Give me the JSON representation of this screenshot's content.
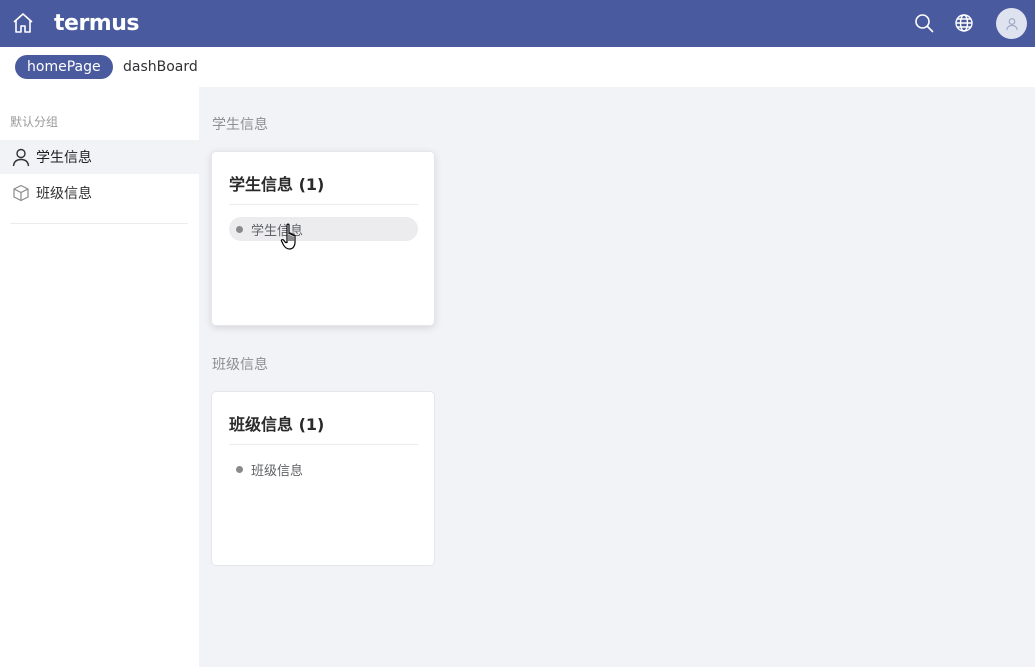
{
  "header": {
    "logo_text": "termus",
    "icons": {
      "home": "home-icon",
      "search": "search-icon",
      "language": "globe-icon",
      "avatar": "user-icon"
    },
    "color": "#4a5a9e"
  },
  "tabs": [
    {
      "label": "homePage",
      "active": true
    },
    {
      "label": "dashBoard",
      "active": false
    }
  ],
  "sidebar": {
    "group_title": "默认分组",
    "items": [
      {
        "label": "学生信息",
        "icon": "user-icon",
        "active": true
      },
      {
        "label": "班级信息",
        "icon": "cube-icon",
        "active": false
      }
    ]
  },
  "sections": [
    {
      "title": "学生信息",
      "card": {
        "title": "学生信息 (1)",
        "links": [
          "学生信息"
        ]
      }
    },
    {
      "title": "班级信息",
      "card": {
        "title": "班级信息 (1)",
        "links": [
          "班级信息"
        ]
      }
    }
  ]
}
